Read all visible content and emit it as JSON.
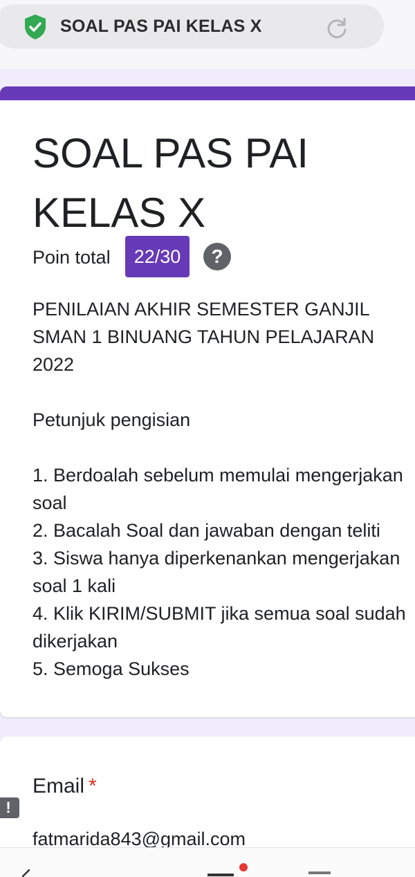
{
  "browser": {
    "tab_title": "SOAL PAS PAI KELAS X",
    "secure_icon": "shield-check-icon",
    "reload_icon": "reload-icon",
    "shield_color": "#34a853"
  },
  "form": {
    "accent_color": "#673ab7",
    "title": "SOAL PAS PAI KELAS X",
    "points_label": "Poin total",
    "points_value": "22/30",
    "help_icon": "?",
    "description": {
      "intro": "PENILAIAN AKHIR SEMESTER GANJIL SMAN 1 BINUANG TAHUN PELAJARAN 2022",
      "instructions_heading": "Petunjuk pengisian",
      "instructions": [
        "1. Berdoalah sebelum memulai mengerjakan soal",
        "2. Bacalah Soal dan jawaban dengan teliti",
        "3. Siswa hanya diperkenankan mengerjakan soal 1 kali",
        "4. Klik KIRIM/SUBMIT jika semua soal sudah dikerjakan",
        "5. Semoga Sukses"
      ]
    }
  },
  "email_question": {
    "label": "Email",
    "required_mark": "*",
    "value": "fatmarida843@gmail.com",
    "alert_icon": "!"
  },
  "system_nav": {
    "back_icon": "back-icon",
    "home_icon": "home-icon",
    "recents_icon": "recents-icon"
  }
}
